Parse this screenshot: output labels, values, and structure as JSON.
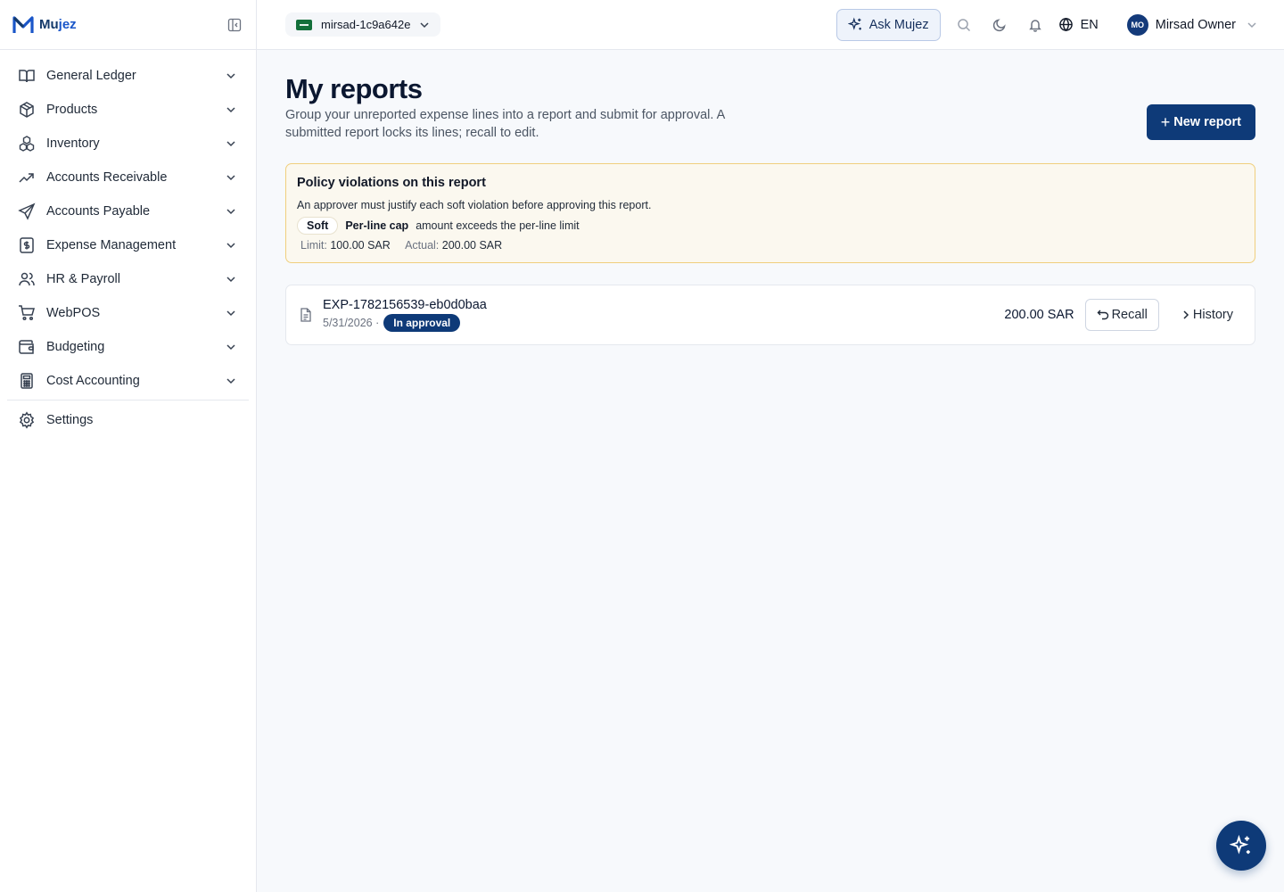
{
  "brand": {
    "name": "Mujez",
    "name_part1": "Mu",
    "name_part2": "jez"
  },
  "sidebar": {
    "items": [
      {
        "label": "General Ledger",
        "icon": "book-icon"
      },
      {
        "label": "Products",
        "icon": "box-icon"
      },
      {
        "label": "Inventory",
        "icon": "boxes-icon"
      },
      {
        "label": "Accounts Receivable",
        "icon": "trending-up-icon"
      },
      {
        "label": "Accounts Payable",
        "icon": "send-icon"
      },
      {
        "label": "Expense Management",
        "icon": "receipt-icon"
      },
      {
        "label": "HR & Payroll",
        "icon": "users-icon"
      },
      {
        "label": "WebPOS",
        "icon": "cart-icon"
      },
      {
        "label": "Budgeting",
        "icon": "wallet-icon"
      },
      {
        "label": "Cost Accounting",
        "icon": "calculator-icon"
      }
    ],
    "settings_label": "Settings"
  },
  "topbar": {
    "tenant": "mirsad-1c9a642e",
    "ask_label": "Ask Mujez",
    "language": "EN",
    "user_initials": "MO",
    "user_name": "Mirsad Owner"
  },
  "page": {
    "title": "My reports",
    "subtitle": "Group your unreported expense lines into a report and submit for approval. A submitted report locks its lines; recall to edit.",
    "new_report_label": "New report"
  },
  "policy_alert": {
    "title": "Policy violations on this report",
    "description": "An approver must justify each soft violation before approving this report.",
    "violation": {
      "severity": "Soft",
      "code": "Per-line cap",
      "message": "amount exceeds the per-line limit",
      "limit_label": "Limit:",
      "limit_value": "100.00 SAR",
      "actual_label": "Actual:",
      "actual_value": "200.00 SAR"
    }
  },
  "reports": [
    {
      "id": "EXP-1782156539-eb0d0baa",
      "date": "5/31/2026 ·",
      "status": "In approval",
      "amount": "200.00 SAR",
      "recall_label": "Recall",
      "history_label": "History"
    }
  ],
  "colors": {
    "primary": "#0e3a78",
    "alert_border": "#f0cf7d",
    "alert_bg": "#fbf8ef",
    "background": "#f7f9fc"
  }
}
